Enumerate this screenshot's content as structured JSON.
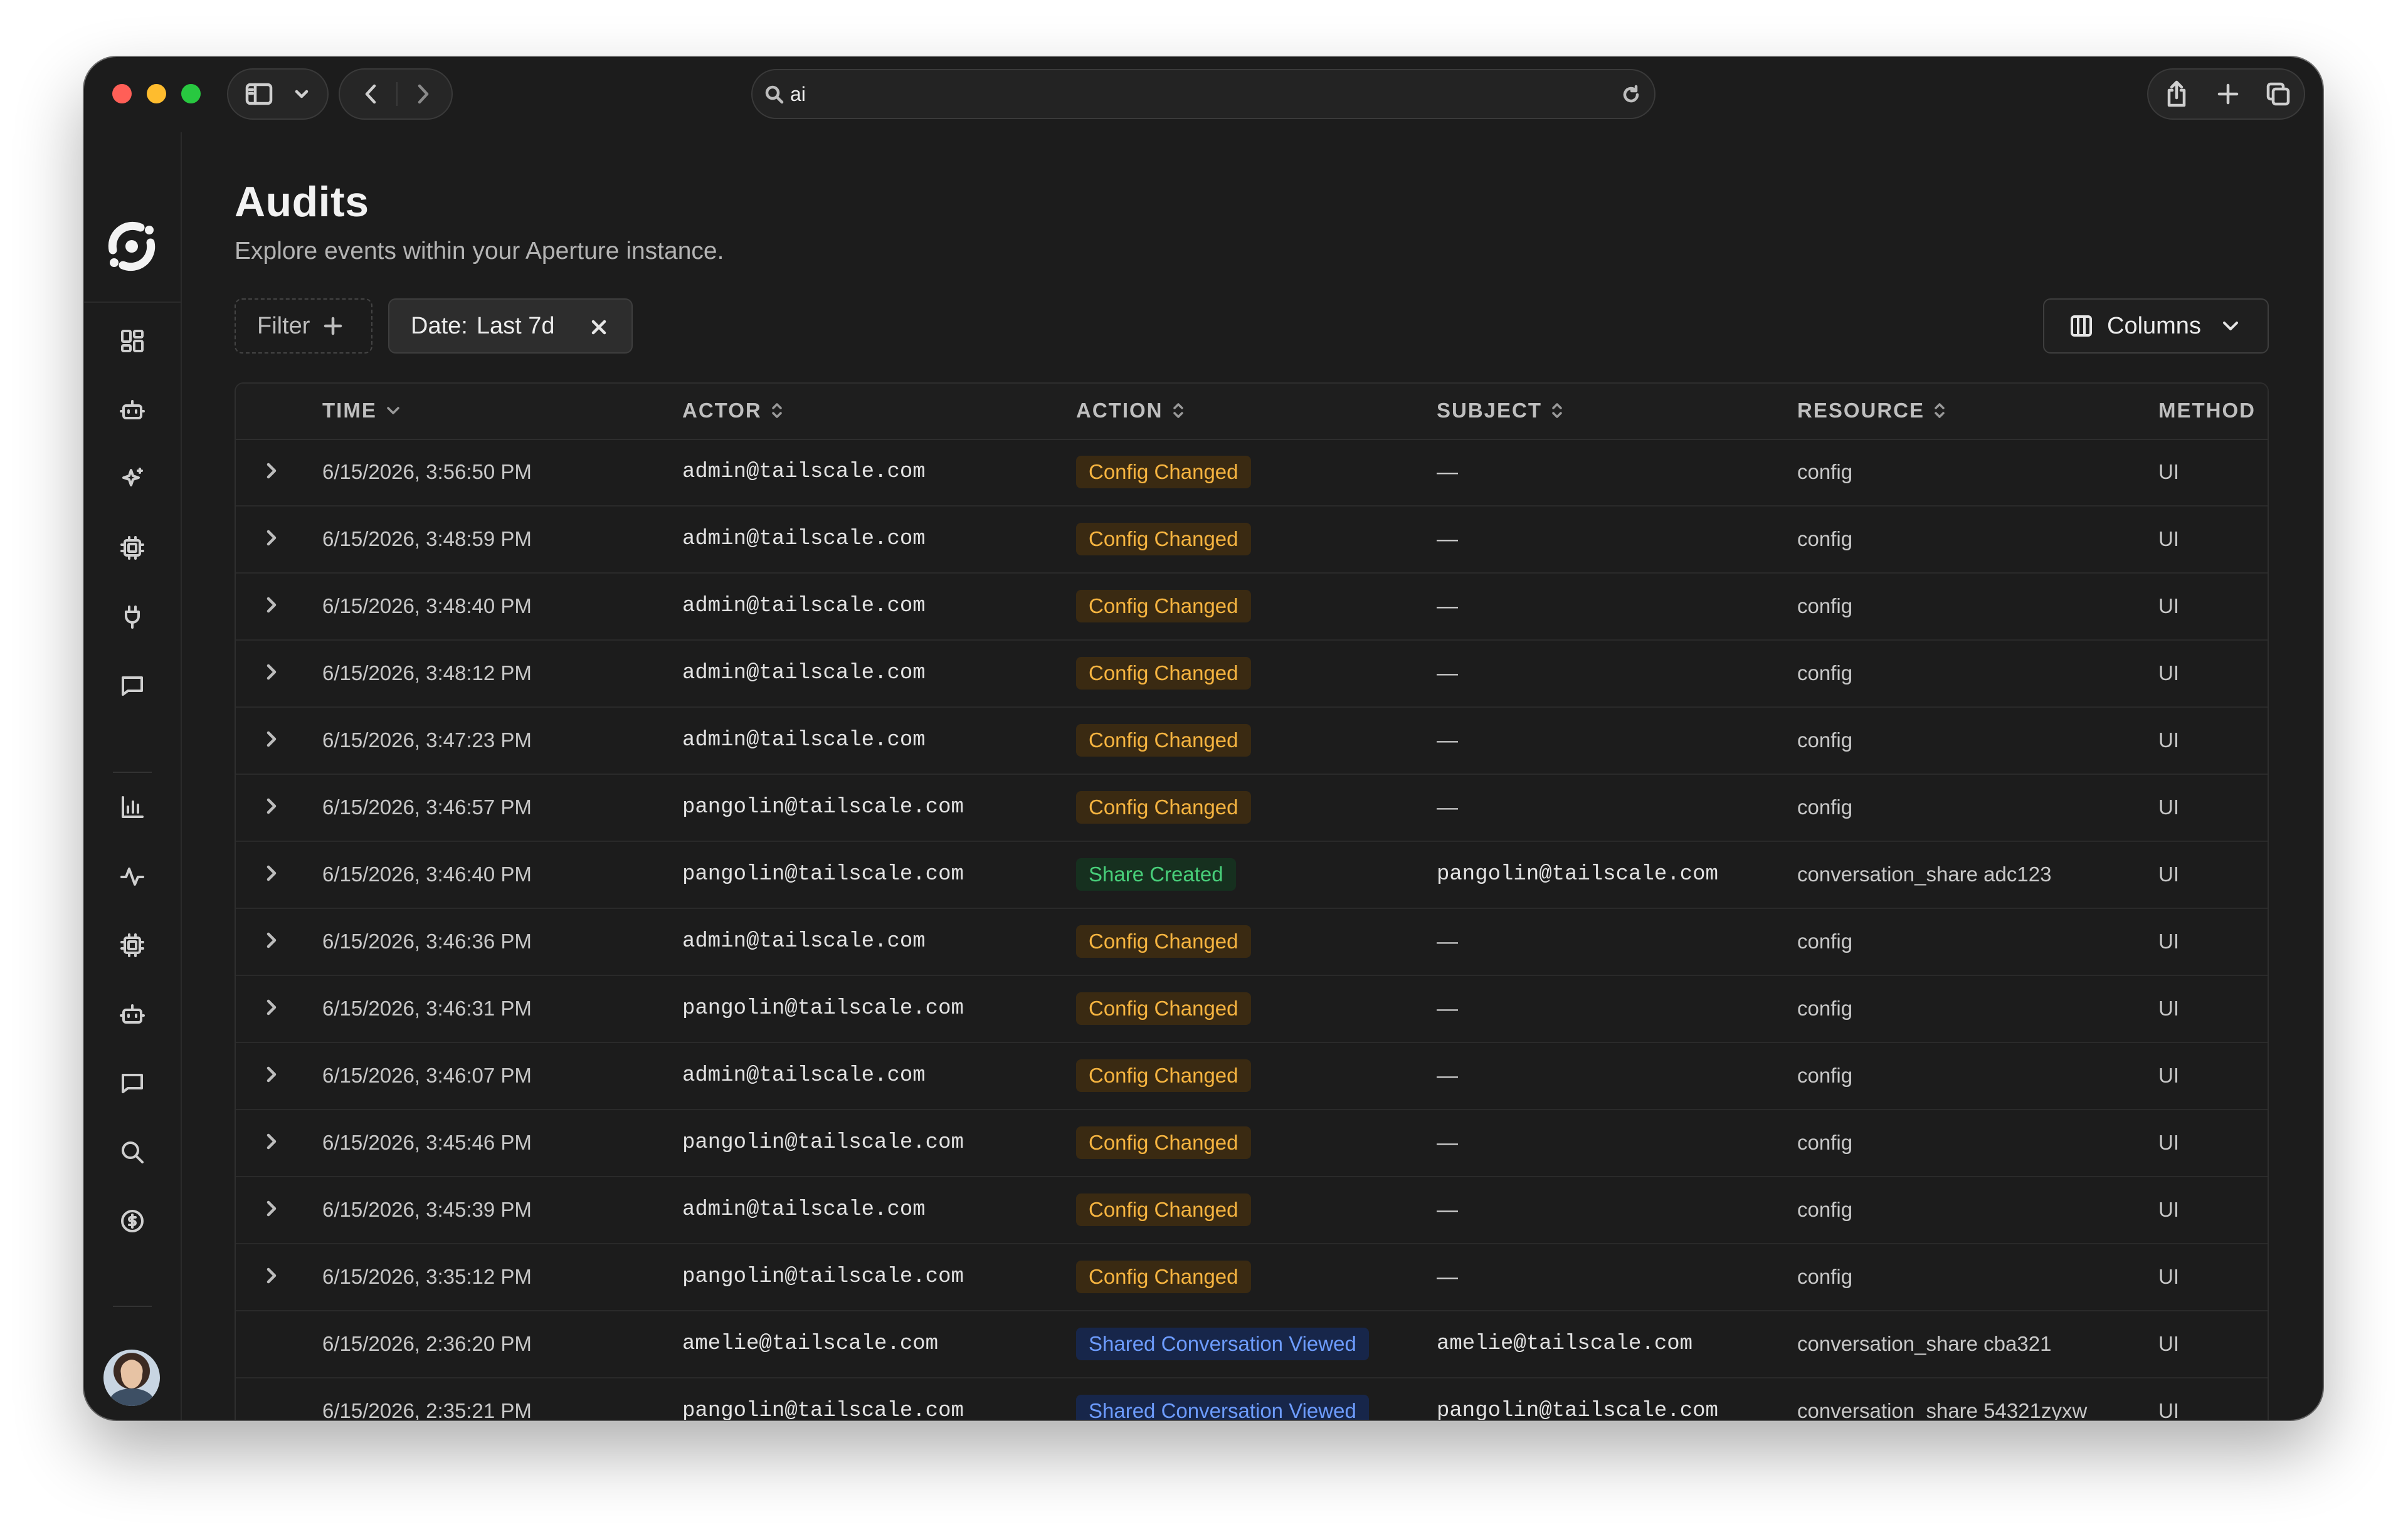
{
  "browser": {
    "address_query": "ai"
  },
  "page": {
    "title": "Audits",
    "subtitle": "Explore events within your Aperture instance."
  },
  "toolbar": {
    "filter_label": "Filter",
    "date_chip_key": "Date:",
    "date_chip_value": "Last 7d",
    "columns_label": "Columns"
  },
  "sidebar": {
    "icons": [
      "dashboard-icon",
      "bot-icon",
      "sparkles-icon",
      "cpu-icon",
      "plug-icon",
      "message-icon",
      "bar-chart-icon",
      "activity-icon",
      "cpu-icon",
      "bot-icon",
      "message-icon",
      "search-icon",
      "dollar-icon"
    ]
  },
  "table": {
    "headers": {
      "time": "TIME",
      "actor": "ACTOR",
      "action": "ACTION",
      "subject": "SUBJECT",
      "resource": "RESOURCE",
      "method": "METHOD"
    },
    "rows": [
      {
        "time": "6/15/2026, 3:56:50 PM",
        "actor": "admin@tailscale.com",
        "action": "Config Changed",
        "type": "orange",
        "subject": "—",
        "resource": "config",
        "method": "UI",
        "expandable": true
      },
      {
        "time": "6/15/2026, 3:48:59 PM",
        "actor": "admin@tailscale.com",
        "action": "Config Changed",
        "type": "orange",
        "subject": "—",
        "resource": "config",
        "method": "UI",
        "expandable": true
      },
      {
        "time": "6/15/2026, 3:48:40 PM",
        "actor": "admin@tailscale.com",
        "action": "Config Changed",
        "type": "orange",
        "subject": "—",
        "resource": "config",
        "method": "UI",
        "expandable": true
      },
      {
        "time": "6/15/2026, 3:48:12 PM",
        "actor": "admin@tailscale.com",
        "action": "Config Changed",
        "type": "orange",
        "subject": "—",
        "resource": "config",
        "method": "UI",
        "expandable": true
      },
      {
        "time": "6/15/2026, 3:47:23 PM",
        "actor": "admin@tailscale.com",
        "action": "Config Changed",
        "type": "orange",
        "subject": "—",
        "resource": "config",
        "method": "UI",
        "expandable": true
      },
      {
        "time": "6/15/2026, 3:46:57 PM",
        "actor": "pangolin@tailscale.com",
        "action": "Config Changed",
        "type": "orange",
        "subject": "—",
        "resource": "config",
        "method": "UI",
        "expandable": true
      },
      {
        "time": "6/15/2026, 3:46:40 PM",
        "actor": "pangolin@tailscale.com",
        "action": "Share Created",
        "type": "green",
        "subject": "pangolin@tailscale.com",
        "resource": "conversation_share adc123",
        "method": "UI",
        "expandable": true
      },
      {
        "time": "6/15/2026, 3:46:36 PM",
        "actor": "admin@tailscale.com",
        "action": "Config Changed",
        "type": "orange",
        "subject": "—",
        "resource": "config",
        "method": "UI",
        "expandable": true
      },
      {
        "time": "6/15/2026, 3:46:31 PM",
        "actor": "pangolin@tailscale.com",
        "action": "Config Changed",
        "type": "orange",
        "subject": "—",
        "resource": "config",
        "method": "UI",
        "expandable": true
      },
      {
        "time": "6/15/2026, 3:46:07 PM",
        "actor": "admin@tailscale.com",
        "action": "Config Changed",
        "type": "orange",
        "subject": "—",
        "resource": "config",
        "method": "UI",
        "expandable": true
      },
      {
        "time": "6/15/2026, 3:45:46 PM",
        "actor": "pangolin@tailscale.com",
        "action": "Config Changed",
        "type": "orange",
        "subject": "—",
        "resource": "config",
        "method": "UI",
        "expandable": true
      },
      {
        "time": "6/15/2026, 3:45:39 PM",
        "actor": "admin@tailscale.com",
        "action": "Config Changed",
        "type": "orange",
        "subject": "—",
        "resource": "config",
        "method": "UI",
        "expandable": true
      },
      {
        "time": "6/15/2026, 3:35:12 PM",
        "actor": "pangolin@tailscale.com",
        "action": "Config Changed",
        "type": "orange",
        "subject": "—",
        "resource": "config",
        "method": "UI",
        "expandable": true
      },
      {
        "time": "6/15/2026, 2:36:20 PM",
        "actor": "amelie@tailscale.com",
        "action": "Shared Conversation Viewed",
        "type": "blue",
        "subject": "amelie@tailscale.com",
        "resource": "conversation_share cba321",
        "method": "UI",
        "expandable": false
      },
      {
        "time": "6/15/2026, 2:35:21 PM",
        "actor": "pangolin@tailscale.com",
        "action": "Shared Conversation Viewed",
        "type": "blue",
        "subject": "pangolin@tailscale.com",
        "resource": "conversation_share 54321zyxw",
        "method": "UI",
        "expandable": false
      }
    ]
  },
  "colors": {
    "orange_badge_text": "#f6b440",
    "green_badge_text": "#48cf7a",
    "blue_badge_text": "#6d9cff",
    "background": "#1c1c1c"
  }
}
